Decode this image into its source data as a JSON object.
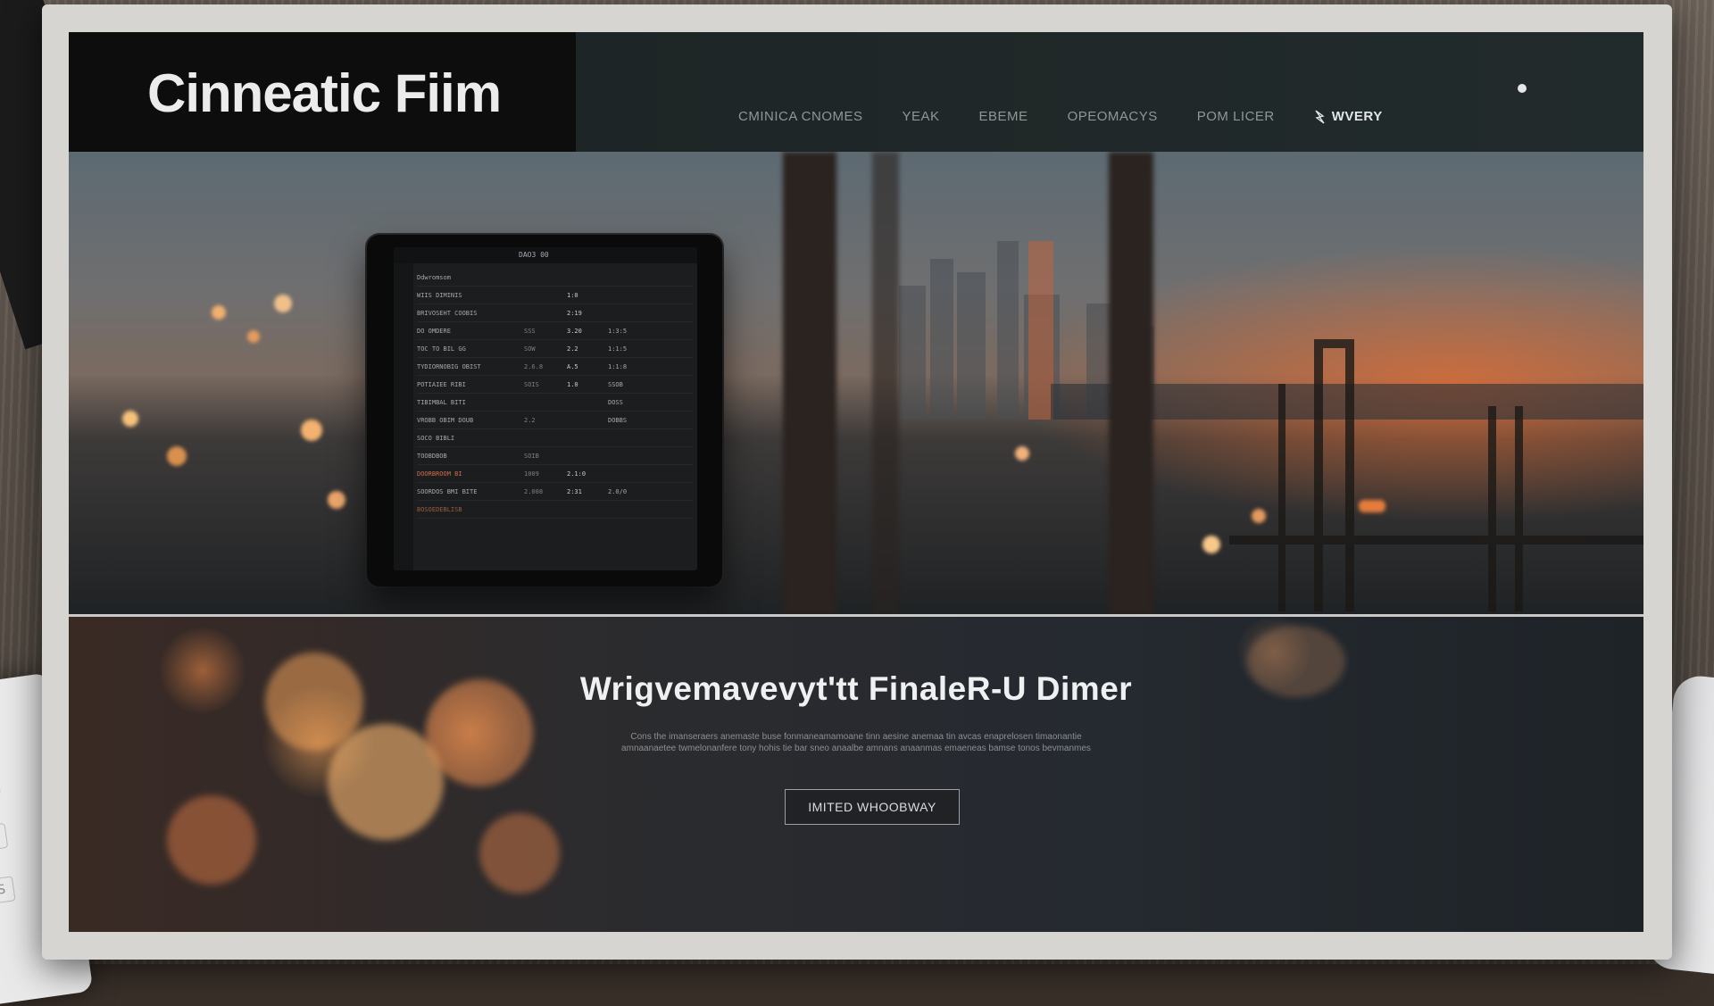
{
  "header": {
    "logo": "Cinneatic Fiim",
    "nav": [
      {
        "label": "CMINICA CNOMES"
      },
      {
        "label": "YEAK"
      },
      {
        "label": "EBEME"
      },
      {
        "label": "OPEOMACYS"
      },
      {
        "label": "POM LICER"
      },
      {
        "label": "WVERY",
        "active": true
      }
    ]
  },
  "tablet": {
    "status": "DAO3 00",
    "rows": [
      {
        "name": "Ddwromsom",
        "v1": "",
        "v2": "",
        "v3": ""
      },
      {
        "name": "WIIS DIMINIS",
        "v1": "",
        "v2": "1:0",
        "v3": ""
      },
      {
        "name": "BRIVOSEHT COOBIS",
        "v1": "",
        "v2": "2:19",
        "v3": ""
      },
      {
        "name": "DO OMDERE",
        "v1": "SSS",
        "v2": "3.20",
        "v3": "1:3:5"
      },
      {
        "name": "TOC TO BIL GG",
        "v1": "SOW",
        "v2": "2.2",
        "v3": "1:1:5"
      },
      {
        "name": "TYDIORNOBIG OBIST",
        "v1": "2.6.8",
        "v2": "A.5",
        "v3": "1:1:8"
      },
      {
        "name": "POTIAIEE RIBI",
        "v1": "SOIS",
        "v2": "1.0",
        "v3": "SSOB"
      },
      {
        "name": "TIBIMBAL BITI",
        "v1": "",
        "v2": "",
        "v3": "DOSS"
      },
      {
        "name": "VROBB OBIM DOUB",
        "v1": "2.2",
        "v2": "",
        "v3": "DOBBS"
      },
      {
        "name": "SOCO BIBLI",
        "v1": "",
        "v2": "",
        "v3": ""
      },
      {
        "name": "TOOBDBOB",
        "v1": "SOIB",
        "v2": "",
        "v3": ""
      },
      {
        "name": "DOORBROOM BI",
        "v1": "1009",
        "v2": "2.1:0",
        "v3": ""
      },
      {
        "name": "SOORDOS BMI BITE",
        "v1": "2.008",
        "v2": "2:31",
        "v3": "2.0/0"
      },
      {
        "name": "BOSOEDEBLISB",
        "v1": "",
        "v2": "",
        "v3": ""
      }
    ]
  },
  "banner": {
    "title": "Wrigvemavevyt'tt FinaleR-U Dimer",
    "description": "Cons the imanseraers anemaste buse fonmaneamamoane tinn aesine anemaa tin avcas enaprelosen timaonantie amnaanaetee twmelonanfere tony hohis tie bar sneo anaalbe amnans anaanmas emaeneas bamse tonos bevmanmes",
    "cta": "IMITED WHOOBWAY"
  },
  "colors": {
    "accent": "#e46a30",
    "header_bg": "#1c2223",
    "logo_bg": "#0d0d0e"
  }
}
